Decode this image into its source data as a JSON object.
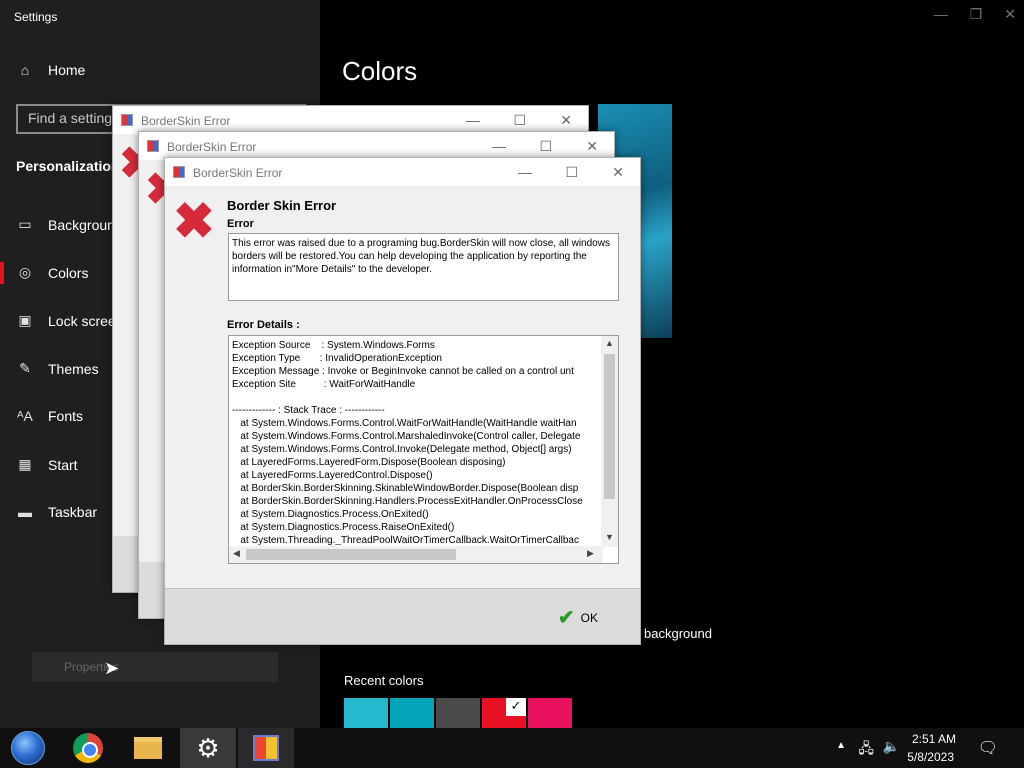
{
  "app": {
    "title": "Settings",
    "page_title": "Colors"
  },
  "nav": {
    "home": "Home",
    "search_placeholder": "Find a setting",
    "section": "Personalization",
    "items": [
      {
        "label": "Background",
        "icon": "image-icon"
      },
      {
        "label": "Colors",
        "icon": "palette-icon"
      },
      {
        "label": "Lock screen",
        "icon": "lock-screen-icon"
      },
      {
        "label": "Themes",
        "icon": "themes-icon"
      },
      {
        "label": "Fonts",
        "icon": "fonts-icon"
      },
      {
        "label": "Start",
        "icon": "start-icon"
      },
      {
        "label": "Taskbar",
        "icon": "taskbar-icon"
      }
    ],
    "props_label": "Properties"
  },
  "content": {
    "bg_text": "background",
    "recent_title": "Recent colors",
    "swatches": [
      "#26b8cc",
      "#00a5b8",
      "#4a4a4a",
      "#e81123",
      "#e8105e"
    ]
  },
  "dialogs": {
    "back_title": "BorderSkin Error",
    "main": {
      "title": "BorderSkin Error",
      "heading": "Border Skin Error",
      "sub": "Error",
      "message": "This error was raised due to a programing bug.BorderSkin will now close, all windows borders will be restored.You can help developing the application by reporting the information in\"More Details\" to the developer.",
      "details_label": "Error Details :",
      "details": "Exception Source    : System.Windows.Forms\nException Type       : InvalidOperationException\nException Message : Invoke or BeginInvoke cannot be called on a control unt\nException Site          : WaitForWaitHandle\n\n------------- : Stack Trace : ------------\n   at System.Windows.Forms.Control.WaitForWaitHandle(WaitHandle waitHan\n   at System.Windows.Forms.Control.MarshaledInvoke(Control caller, Delegate\n   at System.Windows.Forms.Control.Invoke(Delegate method, Object[] args)\n   at LayeredForms.LayeredForm.Dispose(Boolean disposing)\n   at LayeredForms.LayeredControl.Dispose()\n   at BorderSkin.BorderSkinning.SkinableWindowBorder.Dispose(Boolean disp\n   at BorderSkin.BorderSkinning.Handlers.ProcessExitHandler.OnProcessClose\n   at System.Diagnostics.Process.OnExited()\n   at System.Diagnostics.Process.RaiseOnExited()\n   at System.Threading._ThreadPoolWaitOrTimerCallback.WaitOrTimerCallbac",
      "ok_label": "OK"
    }
  },
  "taskbar": {
    "time": "2:51 AM",
    "date": "5/8/2023"
  }
}
